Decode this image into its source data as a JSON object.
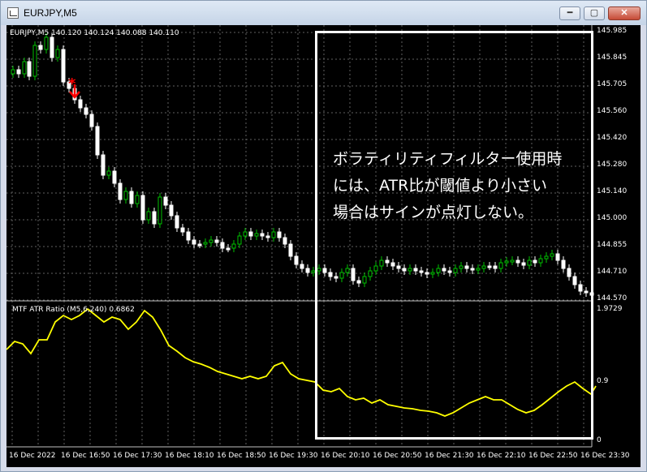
{
  "window": {
    "title": "EURJPY,M5",
    "controls": {
      "minimize": "━",
      "maximize": "▢",
      "close": "✕"
    }
  },
  "chart": {
    "header": "EURJPY,M5  140.120 140.124 140.088 140.110",
    "price_ticks": [
      "145.985",
      "145.845",
      "145.705",
      "145.560",
      "145.420",
      "145.280",
      "145.140",
      "145.000",
      "144.855",
      "144.710",
      "144.570"
    ],
    "indicator_label": "MTF ATR Ratio  (M5,6,240)  0.6862",
    "indicator_ticks": [
      "1.9729",
      "0.9",
      "0"
    ],
    "time_ticks": [
      "16 Dec 2022",
      "16 Dec 16:50",
      "16 Dec 17:30",
      "16 Dec 18:10",
      "16 Dec 18:50",
      "16 Dec 19:30",
      "16 Dec 20:10",
      "16 Dec 20:50",
      "16 Dec 21:30",
      "16 Dec 22:10",
      "16 Dec 22:50",
      "16 Dec 23:30"
    ],
    "annotation": [
      "ボラティリティフィルター使用時",
      "には、ATR比が閾値より小さい",
      "場合はサインが点灯しない。"
    ],
    "signal_marker": "*",
    "colors": {
      "background": "#000000",
      "bull": "#00c000",
      "bear": "#ffffff",
      "indicator": "#ffff00",
      "grid": "#606060",
      "signal": "#ff0000"
    }
  }
}
